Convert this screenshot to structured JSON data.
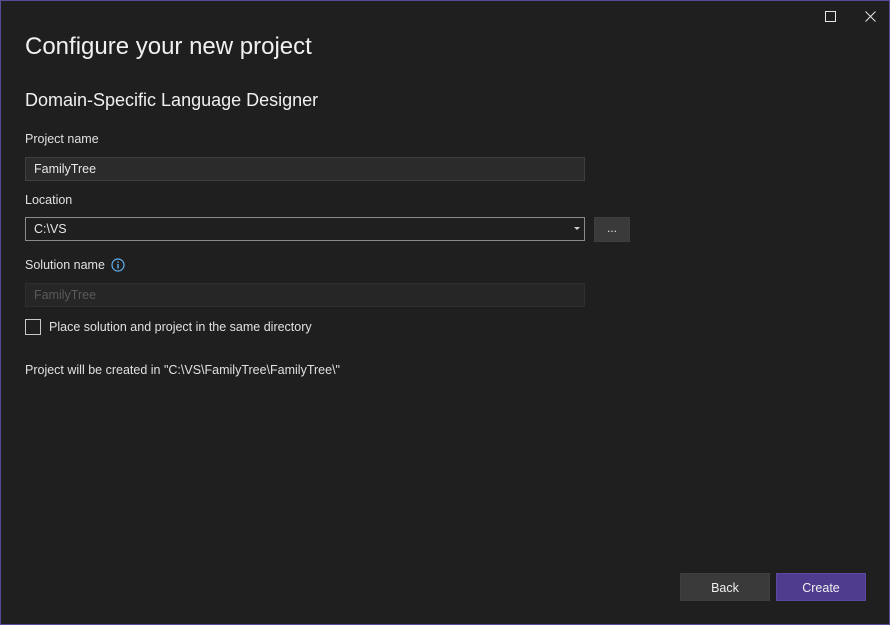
{
  "window": {
    "maximize_icon": "maximize-icon",
    "close_icon": "close-icon",
    "border_color": "#5b4a96"
  },
  "header": {
    "title": "Configure your new project",
    "subtitle": "Domain-Specific Language Designer"
  },
  "form": {
    "project_name_label": "Project name",
    "project_name_value": "FamilyTree",
    "location_label": "Location",
    "location_value": "C:\\VS",
    "browse_label": "...",
    "solution_name_label": "Solution name",
    "solution_name_value": "FamilyTree",
    "info_icon": "info-icon",
    "same_directory_label": "Place solution and project in the same directory",
    "same_directory_checked": false,
    "status_text": "Project will be created in \"C:\\VS\\FamilyTree\\FamilyTree\\\""
  },
  "footer": {
    "back_label": "Back",
    "create_label": "Create",
    "create_color": "#4f3c8f"
  }
}
